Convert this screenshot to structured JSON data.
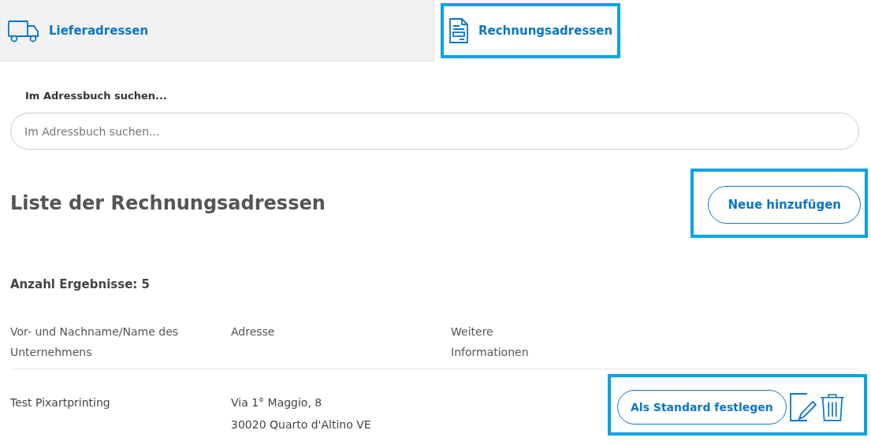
{
  "tabs": [
    {
      "label": "Lieferadressen",
      "kind": "truck",
      "selected": false,
      "highlighted": false
    },
    {
      "label": "Rechnungsadressen",
      "kind": "document",
      "selected": true,
      "highlighted": true
    }
  ],
  "search": {
    "label": "Im Adressbuch suchen...",
    "placeholder": "Im Adressbuch suchen..."
  },
  "list_title": "Liste der Rechnungsadressen",
  "add_button": {
    "label": "Neue hinzufügen",
    "highlighted": true
  },
  "result_count": "Anzahl Ergebnisse: 5",
  "table": {
    "columns": [
      "Vor- und Nachname/Name des Unternehmens",
      "Adresse",
      "Weitere Informationen"
    ],
    "rows": [
      {
        "name": "Test Pixartprinting",
        "address": [
          "Via 1° Maggio, 8",
          "30020 Quarto d'Altino VE"
        ],
        "default_button": "Als Standard festlegen",
        "highlighted": true
      }
    ]
  }
}
